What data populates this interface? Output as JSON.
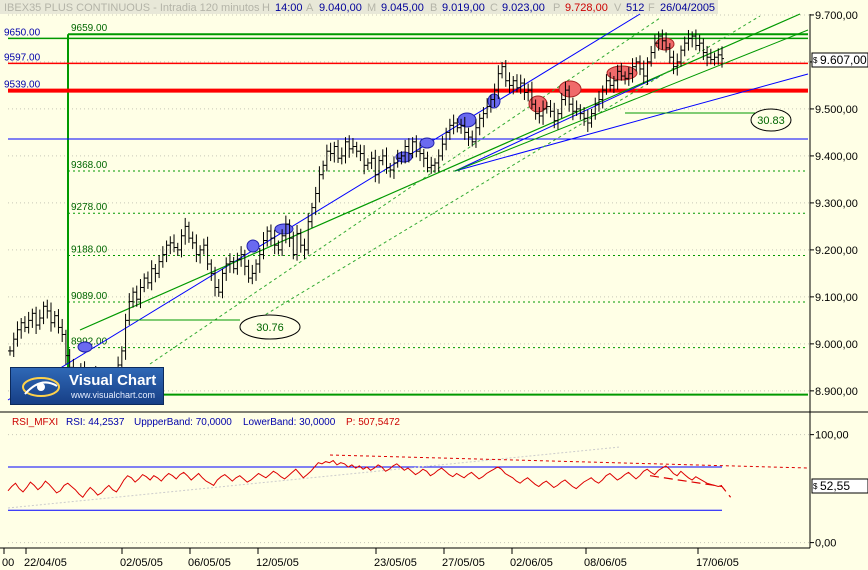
{
  "header": {
    "title": "IBEX35 PLUS CONTINUOUS - Intradia 120 minutos",
    "h_label": "H",
    "time": "14:00",
    "open": "9.040,00",
    "m_label": "M",
    "high": "9.045,00",
    "b_label": "B",
    "low": "9.019,00",
    "c_label": "C",
    "close": "9.023,00",
    "p_label": "P",
    "p_value": "9.728,00",
    "v_label": "V",
    "volume": "512",
    "f_label": "F",
    "date": "26/04/2005"
  },
  "logo": {
    "name": "Visual Chart",
    "url": "www.visualchart.com"
  },
  "price_badge": "9.607,00",
  "rsi_badge": "52,55",
  "rsi_header": {
    "name": "RSI_MFXI",
    "rsi": "RSI: 44,2537",
    "upper": "UppperBand: 70,0000",
    "lower": "LowerBand: 30,0000",
    "p": "P: 507,5472"
  },
  "annotations": {
    "ellipse_1": "30.76",
    "ellipse_2": "30.83"
  },
  "colors": {
    "background": "#ffffe6",
    "candles": "#000000",
    "blue_lines": "#0000ff",
    "green_lines": "#009900",
    "red_lines": "#ff0000",
    "rsi_line": "#dd0000"
  },
  "chart_data": {
    "type": "candlestick",
    "x_ticks": [
      "00",
      "22/04/05",
      "02/05/05",
      "06/05/05",
      "12/05/05",
      "23/05/05",
      "27/05/05",
      "02/06/05",
      "08/06/05",
      "17/06/05"
    ],
    "y_ticks": [
      "9.700,00",
      "9.600,00",
      "9.500,00",
      "9.400,00",
      "9.300,00",
      "9.200,00",
      "9.100,00",
      "9.000,00",
      "8.900,00"
    ],
    "y_values": [
      9700,
      9600,
      9500,
      9400,
      9300,
      9200,
      9100,
      9000,
      8900
    ],
    "ylim": [
      8855,
      9702
    ],
    "blue_levels": [
      {
        "label": "9650.00",
        "value": 9650
      },
      {
        "label": "9597.00",
        "value": 9597
      },
      {
        "label": "9539.00",
        "value": 9539
      }
    ],
    "green_levels": [
      {
        "label": "9659.00",
        "value": 9659
      },
      {
        "label": "9368.00",
        "value": 9368
      },
      {
        "label": "9278.00",
        "value": 9278
      },
      {
        "label": "9188.00",
        "value": 9188
      },
      {
        "label": "9089.00",
        "value": 9089
      },
      {
        "label": "8992.00",
        "value": 8992
      }
    ],
    "close_series": [
      8985,
      9010,
      9030,
      9045,
      9035,
      9050,
      9065,
      9040,
      9055,
      9080,
      9070,
      9045,
      9060,
      9035,
      9020,
      8975,
      8950,
      8925,
      8935,
      8945,
      8915,
      8900,
      8920,
      8935,
      8920,
      8895,
      8905,
      8925,
      8910,
      8955,
      8985,
      9050,
      9090,
      9110,
      9095,
      9120,
      9140,
      9130,
      9160,
      9150,
      9175,
      9190,
      9210,
      9215,
      9205,
      9200,
      9230,
      9250,
      9225,
      9215,
      9190,
      9200,
      9210,
      9170,
      9150,
      9120,
      9110,
      9150,
      9170,
      9175,
      9160,
      9180,
      9190,
      9165,
      9140,
      9150,
      9170,
      9190,
      9220,
      9240,
      9225,
      9210,
      9200,
      9230,
      9255,
      9225,
      9190,
      9235,
      9210,
      9200,
      9260,
      9290,
      9320,
      9360,
      9380,
      9410,
      9405,
      9420,
      9395,
      9400,
      9430,
      9415,
      9420,
      9410,
      9405,
      9380,
      9385,
      9395,
      9360,
      9390,
      9400,
      9375,
      9370,
      9385,
      9395,
      9400,
      9420,
      9405,
      9430,
      9410,
      9405,
      9395,
      9375,
      9380,
      9385,
      9400,
      9425,
      9450,
      9465,
      9470,
      9460,
      9465,
      9450,
      9440,
      9430,
      9460,
      9480,
      9490,
      9505,
      9520,
      9540,
      9575,
      9590,
      9560,
      9550,
      9560,
      9545,
      9555,
      9535,
      9540,
      9510,
      9490,
      9485,
      9500,
      9505,
      9495,
      9475,
      9490,
      9520,
      9540,
      9510,
      9495,
      9500,
      9490,
      9480,
      9470,
      9490,
      9510,
      9520,
      9540,
      9560,
      9550,
      9560,
      9580,
      9570,
      9565,
      9575,
      9590,
      9600,
      9585,
      9570,
      9600,
      9620,
      9640,
      9655,
      9645,
      9630,
      9610,
      9590,
      9600,
      9625,
      9640,
      9650,
      9655,
      9635,
      9640,
      9620,
      9610,
      9605,
      9610,
      9615,
      9607
    ],
    "rsi_ylim": [
      -5,
      108
    ],
    "rsi_y_ticks": [
      "100,00",
      "0,00"
    ],
    "rsi_y_values": [
      100,
      0
    ],
    "rsi_bands": [
      70,
      30
    ],
    "rsi_series": [
      48,
      52,
      55,
      50,
      47,
      51,
      56,
      53,
      49,
      52,
      57,
      54,
      50,
      46,
      48,
      53,
      55,
      52,
      49,
      45,
      42,
      47,
      51,
      48,
      44,
      46,
      50,
      53,
      49,
      47,
      52,
      58,
      62,
      60,
      56,
      59,
      63,
      61,
      58,
      62,
      60,
      57,
      61,
      64,
      62,
      59,
      63,
      65,
      62,
      58,
      61,
      64,
      60,
      57,
      55,
      53,
      58,
      61,
      63,
      60,
      57,
      60,
      62,
      59,
      56,
      58,
      61,
      64,
      62,
      60,
      63,
      66,
      64,
      61,
      59,
      62,
      65,
      68,
      64,
      60,
      63,
      66,
      70,
      74,
      73,
      75,
      74,
      76,
      72,
      74,
      73,
      70,
      72,
      69,
      71,
      68,
      70,
      67,
      69,
      72,
      70,
      66,
      68,
      71,
      73,
      70,
      67,
      69,
      66,
      63,
      65,
      68,
      66,
      62,
      64,
      67,
      69,
      66,
      63,
      61,
      64,
      62,
      60,
      63,
      65,
      62,
      59,
      61,
      64,
      66,
      68,
      70,
      68,
      64,
      62,
      60,
      57,
      55,
      58,
      60,
      57,
      54,
      52,
      55,
      57,
      54,
      51,
      53,
      56,
      58,
      55,
      52,
      50,
      53,
      56,
      58,
      60,
      57,
      55,
      58,
      62,
      64,
      61,
      58,
      60,
      63,
      65,
      62,
      59,
      62,
      66,
      68,
      65,
      63,
      67,
      69,
      71,
      68,
      64,
      62,
      66,
      63,
      60,
      58,
      61,
      59,
      57,
      55,
      54,
      53,
      52,
      53
    ],
    "rsi_trend_projection": [
      [
        0,
        62
      ],
      [
        1,
        52
      ],
      [
        1.12,
        42
      ]
    ]
  }
}
